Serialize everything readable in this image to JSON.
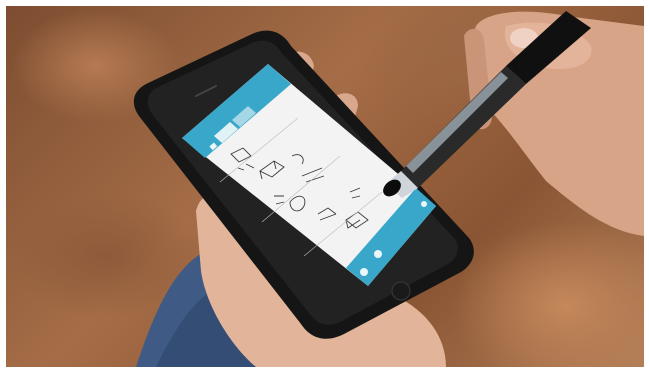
{
  "screen": {
    "status_time": "",
    "app_title": "",
    "tabs": [
      "",
      ""
    ],
    "accent_color": "#39a7c9"
  },
  "icons": [
    "pen-icon",
    "menu-icon",
    "share-icon",
    "add-icon"
  ]
}
